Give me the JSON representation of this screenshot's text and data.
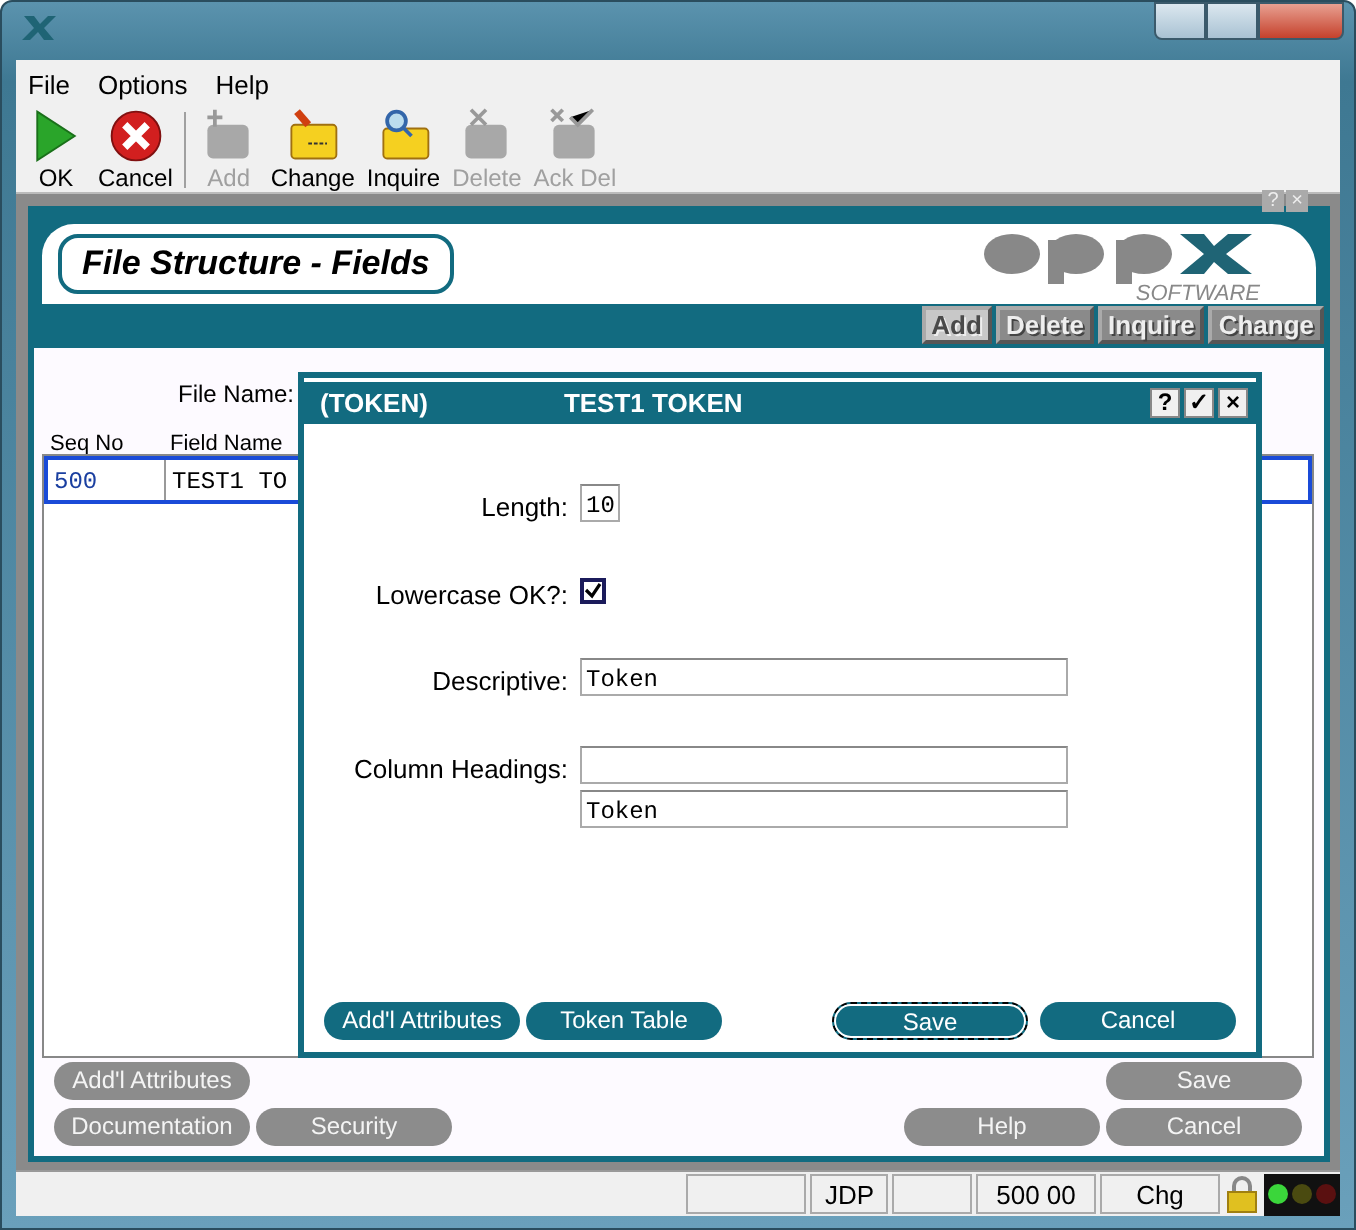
{
  "menu": [
    "File",
    "Options",
    "Help"
  ],
  "toolbar": [
    {
      "kind": "ok",
      "label": "OK",
      "disabled": false
    },
    {
      "kind": "cancel",
      "label": "Cancel",
      "disabled": false
    },
    {
      "kind": "add",
      "label": "Add",
      "disabled": true
    },
    {
      "kind": "change",
      "label": "Change",
      "disabled": false
    },
    {
      "kind": "inquire",
      "label": "Inquire",
      "disabled": false
    },
    {
      "kind": "delete",
      "label": "Delete",
      "disabled": true
    },
    {
      "kind": "ackdel",
      "label": "Ack Del",
      "disabled": true
    }
  ],
  "header": {
    "title": "File Structure - Fields",
    "logo_sub": "SOFTWARE",
    "help": "?",
    "close": "×"
  },
  "modes": [
    {
      "label": "Add",
      "selected": true
    },
    {
      "label": "Delete",
      "selected": false
    },
    {
      "label": "Inquire",
      "selected": false
    },
    {
      "label": "Change",
      "selected": false
    }
  ],
  "file_name_label": "File Name:",
  "table": {
    "columns": [
      "Seq No",
      "Field Name"
    ],
    "rows": [
      [
        "500",
        "TEST1 TO"
      ]
    ]
  },
  "buttons_row1": {
    "left": [
      "Add'l Attributes"
    ],
    "right": [
      "Save"
    ]
  },
  "buttons_row2": {
    "left": [
      "Documentation",
      "Security"
    ],
    "right": [
      "Help",
      "Cancel"
    ]
  },
  "dialog": {
    "code": "(TOKEN)",
    "title": "TEST1 TOKEN",
    "controls": [
      "?",
      "✓",
      "×"
    ],
    "fields": [
      {
        "kind": "short",
        "label": "Length:",
        "value": "10"
      },
      {
        "kind": "check",
        "label": "Lowercase OK?:",
        "checked": true
      },
      {
        "kind": "text",
        "label": "Descriptive:",
        "value": "Token"
      },
      {
        "kind": "multi",
        "label": "Column Headings:",
        "line_2": "Token"
      }
    ],
    "buttons_left": [
      {
        "label": "Add'l Attributes",
        "focused": false
      },
      {
        "label": "Token Table",
        "focused": false
      }
    ],
    "buttons_right": [
      {
        "label": "Save",
        "focused": true
      },
      {
        "label": "Cancel",
        "focused": false
      }
    ]
  },
  "status_bar": {
    "user": "JDP",
    "position": "500 00",
    "mode": "Chg"
  }
}
